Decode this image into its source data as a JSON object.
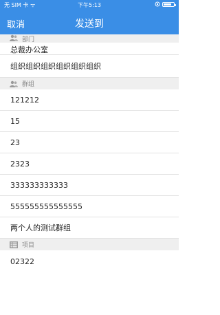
{
  "status_bar": {
    "carrier": "无 SIM 卡 ᯤ",
    "time": "下午5:13",
    "battery_level": 0.8
  },
  "nav": {
    "cancel_label": "取消",
    "title": "发送到"
  },
  "sections": {
    "departments": {
      "header": "部门",
      "icon": "users-icon",
      "items": [
        "总裁办公室",
        "组织组织组织组织组织组织"
      ]
    },
    "groups": {
      "header": "群组",
      "icon": "users-icon",
      "items": [
        "121212",
        "15",
        "23",
        "2323",
        "333333333333",
        "555555555555555",
        "两个人的测试群组"
      ]
    },
    "projects": {
      "header": "项目",
      "icon": "list-icon",
      "items": [
        "02322"
      ]
    }
  }
}
